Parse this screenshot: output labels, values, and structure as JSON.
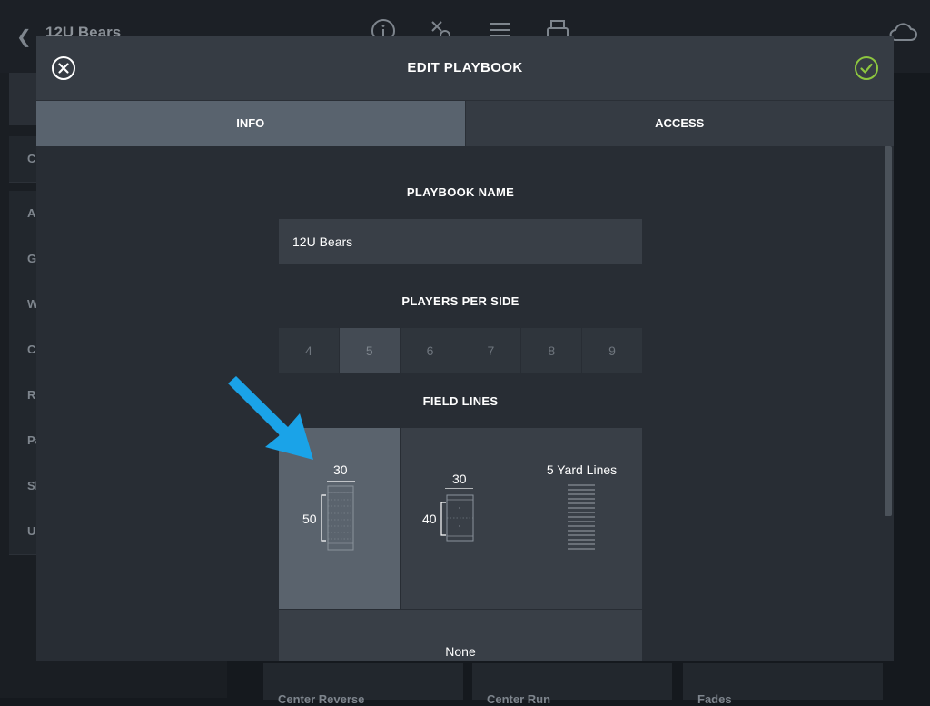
{
  "background": {
    "title": "12U Bears",
    "sidebar_items": [
      "C",
      "Al",
      "Ga",
      "W",
      "Co",
      "Ru",
      "Pa",
      "Sh",
      "Ur"
    ],
    "cards": [
      "Center Reverse",
      "Center Run",
      "Fades"
    ]
  },
  "modal": {
    "title": "EDIT PLAYBOOK",
    "close_icon": "close-circle-icon",
    "confirm_icon": "check-circle-icon",
    "tabs": [
      {
        "label": "INFO",
        "active": true
      },
      {
        "label": "ACCESS",
        "active": false
      }
    ],
    "playbook_name": {
      "label": "PLAYBOOK NAME",
      "value": "12U Bears"
    },
    "players_per_side": {
      "label": "PLAYERS PER SIDE",
      "options": [
        "4",
        "5",
        "6",
        "7",
        "8",
        "9"
      ],
      "selected": "5"
    },
    "field_lines": {
      "label": "FIELD LINES",
      "options": [
        {
          "width": "30",
          "length": "50",
          "selected": true
        },
        {
          "width": "30",
          "length": "40",
          "selected": false
        },
        {
          "title": "5 Yard Lines",
          "selected": false
        },
        {
          "title": "None",
          "selected": false
        }
      ]
    }
  },
  "colors": {
    "accent_green": "#8dc63f",
    "arrow_blue": "#1aa3e8"
  }
}
